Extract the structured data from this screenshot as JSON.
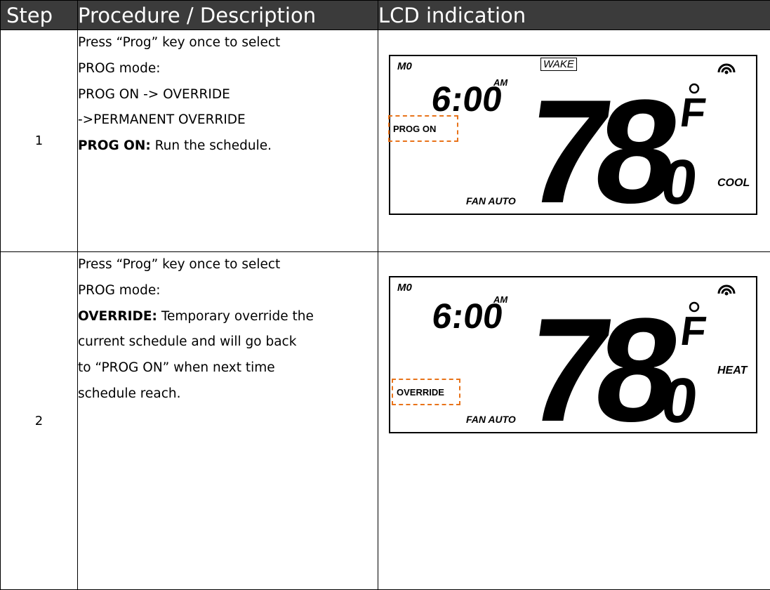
{
  "headers": {
    "step": "Step",
    "procedure": "Procedure / Description",
    "lcd": "LCD indication"
  },
  "rows": [
    {
      "step": "1",
      "lines": [
        "Press “Prog” key once to select",
        "PROG mode:",
        "PROG ON -> OVERRIDE",
        "->PERMANENT OVERRIDE"
      ],
      "bold_label": "PROG ON:",
      "bold_rest": " Run the schedule.",
      "lcd": {
        "day": "M0",
        "time": "6:00",
        "ampm": "AM",
        "period": "WAKE",
        "temp": "78",
        "decimal": "0",
        "unit": "F",
        "status": "PROG ON",
        "fan": "FAN AUTO",
        "mode": "COOL",
        "icon": "wifi-signal-icon",
        "highlight_color": "#e8731a"
      }
    },
    {
      "step": "2",
      "lines": [
        "Press “Prog” key once to select",
        "PROG mode:"
      ],
      "bold_label": "OVERRIDE:",
      "bold_rest": " Temporary override the",
      "more_lines": [
        "current schedule and will go back",
        "to “PROG ON” when next time",
        "schedule reach."
      ],
      "lcd": {
        "day": "M0",
        "time": "6:00",
        "ampm": "AM",
        "temp": "78",
        "decimal": "0",
        "unit": "F",
        "status": "OVERRIDE",
        "fan": "FAN AUTO",
        "mode": "HEAT",
        "icon": "wifi-signal-icon",
        "highlight_color": "#e8731a"
      }
    }
  ]
}
